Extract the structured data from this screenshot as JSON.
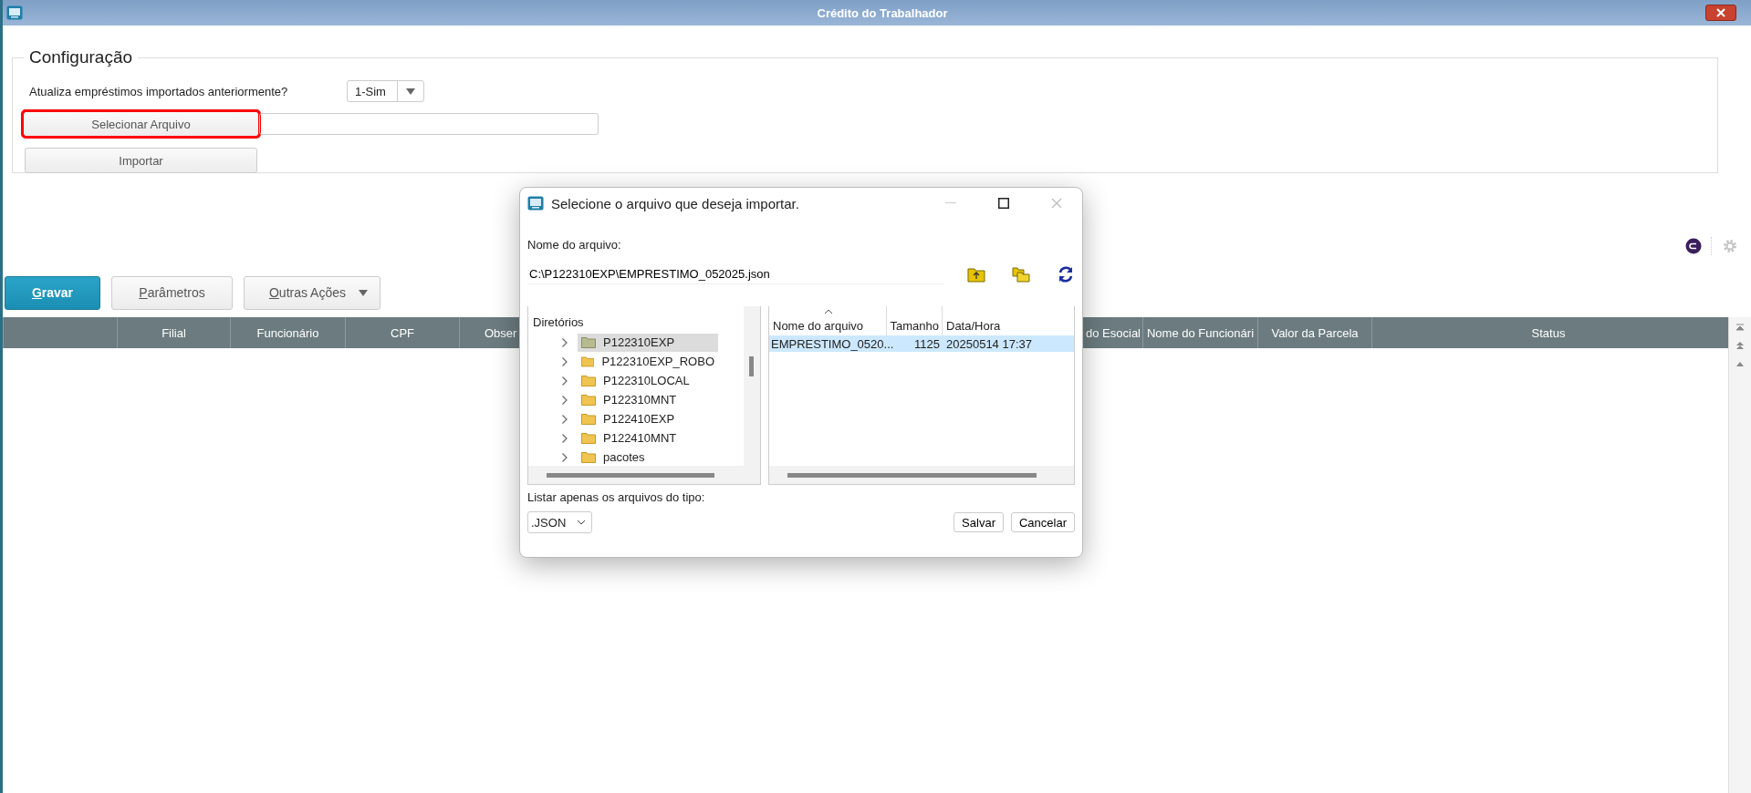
{
  "window": {
    "title": "Crédito do Trabalhador"
  },
  "config": {
    "legend": "Configuração",
    "question": "Atualiza empréstimos importados anteriormente?",
    "answer": "1-Sim",
    "buttons": [
      {
        "label": "Selecionar Arquivo",
        "highlighted": true,
        "kind": "file"
      },
      {
        "label": "Importar",
        "highlighted": false,
        "kind": "plain"
      }
    ]
  },
  "toolbar": [
    {
      "label": "Gravar",
      "kind": "primary"
    },
    {
      "label": "Parâmetros",
      "kind": "plain"
    },
    {
      "label": "Outras Ações",
      "kind": "menu"
    }
  ],
  "table": {
    "columns": [
      "",
      "Filial",
      "Funcionário",
      "CPF",
      "Obser",
      "do Esocial",
      "Nome do Funcionári",
      "Valor da Parcela",
      "Status"
    ]
  },
  "dialog": {
    "title": "Selecione o arquivo que deseja importar.",
    "file_name_label": "Nome do arquivo:",
    "file_name_value": "C:\\P122310EXP\\EMPRESTIMO_052025.json",
    "directories_header": "Diretórios",
    "directories": [
      {
        "name": "P122310EXP",
        "selected": true
      },
      {
        "name": "P122310EXP_ROBO",
        "selected": false
      },
      {
        "name": "P122310LOCAL",
        "selected": false
      },
      {
        "name": "P122310MNT",
        "selected": false
      },
      {
        "name": "P122410EXP",
        "selected": false
      },
      {
        "name": "P122410MNT",
        "selected": false
      },
      {
        "name": "pacotes",
        "selected": false
      }
    ],
    "file_columns": [
      "Nome do arquivo",
      "Tamanho",
      "Data/Hora"
    ],
    "files": [
      {
        "name": "EMPRESTIMO_0520...",
        "size": "1125",
        "date": "20250514 17:37",
        "selected": true
      }
    ],
    "filter_label": "Listar apenas os arquivos do tipo:",
    "filter_value": ".JSON",
    "buttons": [
      "Salvar",
      "Cancelar"
    ]
  }
}
